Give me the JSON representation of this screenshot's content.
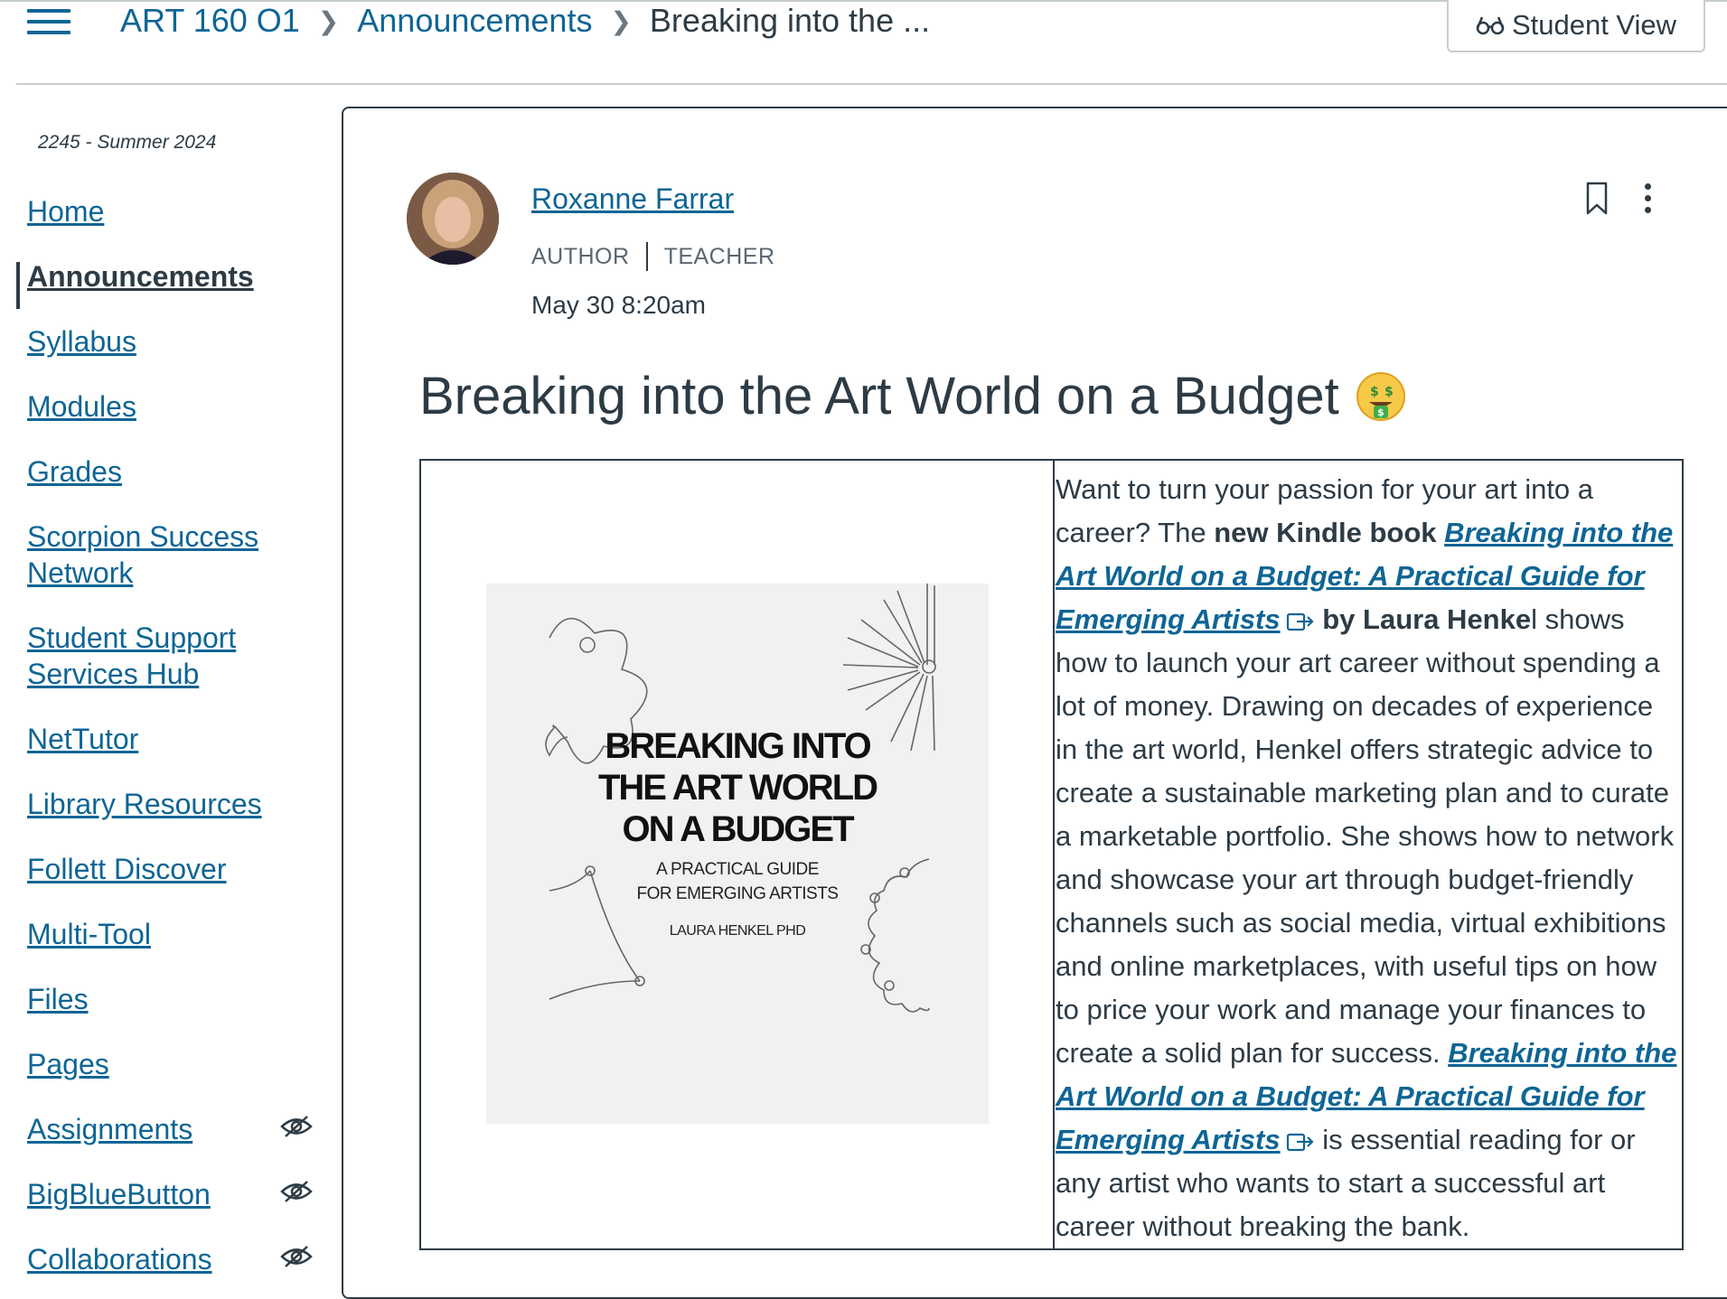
{
  "breadcrumb": {
    "course": "ART 160 O1",
    "section": "Announcements",
    "current": "Breaking into the ..."
  },
  "student_view_label": "Student View",
  "term": "2245 - Summer 2024",
  "nav": {
    "items": [
      {
        "label": "Home"
      },
      {
        "label": "Announcements",
        "active": true
      },
      {
        "label": "Syllabus"
      },
      {
        "label": "Modules"
      },
      {
        "label": "Grades"
      },
      {
        "label": "Scorpion Success Network"
      },
      {
        "label": "Student Support Services Hub"
      },
      {
        "label": "NetTutor"
      },
      {
        "label": "Library Resources"
      },
      {
        "label": "Follett Discover"
      },
      {
        "label": "Multi-Tool"
      },
      {
        "label": "Files"
      },
      {
        "label": "Pages"
      },
      {
        "label": "Assignments",
        "hidden_from_students": true
      },
      {
        "label": "BigBlueButton",
        "hidden_from_students": true
      },
      {
        "label": "Collaborations",
        "hidden_from_students": true
      }
    ]
  },
  "post": {
    "author": "Roxanne Farrar",
    "role_1": "AUTHOR",
    "role_2": "TEACHER",
    "date": "May 30 8:20am",
    "title": "Breaking into the Art World on a Budget",
    "title_emoji": "money-mouth-face",
    "body": {
      "p1": "Want to turn your passion for your art into a career? The ",
      "p2_bold": "new Kindle book ",
      "link1": "Breaking into the Art World on a Budget: A Practical Guide for Emerging Artists",
      "p3_bold": " by Laura Henke",
      "p4": "l shows how to launch your art career without spending a lot of money. Drawing on decades of experience in the art world, Henkel offers strategic advice to create a sustainable marketing plan and to curate a marketable portfolio. She shows how to network and showcase your art through budget-friendly channels such as social media, virtual exhibitions and online marketplaces, with useful tips on how to price your work and manage your finances to create a solid plan for success. ",
      "link2": "Breaking into the Art World on a Budget: A Practical Guide for Emerging Artists",
      "p5": " is essential reading for or any artist who wants to start a successful art career without breaking the bank."
    },
    "book_cover": {
      "title_l1": "BREAKING INTO",
      "title_l2": "THE ART WORLD",
      "title_l3": "ON A BUDGET",
      "subtitle_l1": "A PRACTICAL GUIDE",
      "subtitle_l2": "FOR EMERGING ARTISTS",
      "author": "LAURA HENKEL PHD"
    }
  },
  "colors": {
    "link": "#0e6595",
    "text": "#2d3b45",
    "border": "#c7cdd1"
  },
  "icons": {
    "menu": "hamburger-icon",
    "student_view": "glasses-icon",
    "bookmark": "bookmark-icon",
    "more": "kebab-icon",
    "hidden": "eye-slash-icon",
    "external": "external-link-icon"
  }
}
